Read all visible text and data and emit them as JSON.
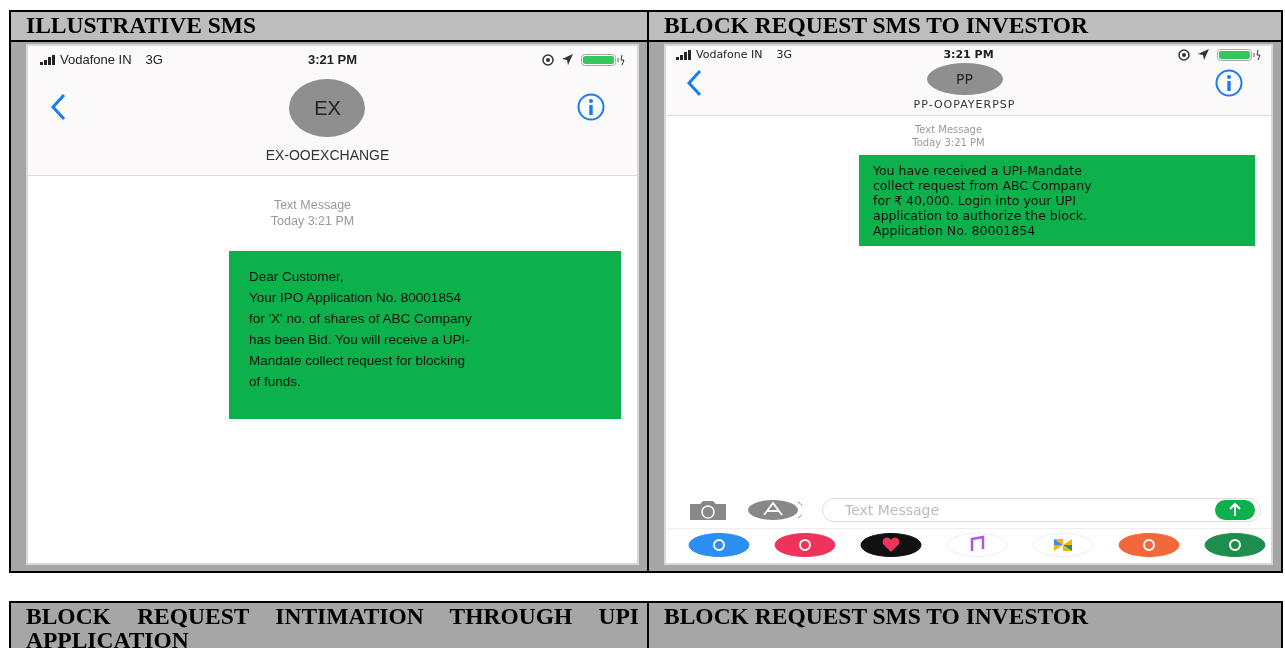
{
  "panels": [
    {
      "heading": "ILLUSTRATIVE SMS",
      "phone": {
        "carrier": "Vodafone IN",
        "network": "3G",
        "time": "3:21 PM",
        "contact_initials": "EX",
        "contact_name": "EX-OOEXCHANGE",
        "message_type": "Text Message",
        "message_time": "Today 3:21 PM",
        "message_text": "Dear Customer,\nYour IPO Application No. 80001854\nfor 'X' no. of shares of ABC Company\nhas been Bid. You will receive a UPI-\nMandate collect request for blocking\nof funds."
      }
    },
    {
      "heading": "BLOCK REQUEST SMS TO INVESTOR",
      "phone": {
        "carrier": "Vodafone IN",
        "network": "3G",
        "time": "3:21 PM",
        "contact_initials": "PP",
        "contact_name": "PP-OOPAYERPSP",
        "message_type": "Text Message",
        "message_time": "Today 3:21 PM",
        "message_text": "You have received a UPI-Mandate\ncollect request from ABC Company\nfor ₹ 40,000. Login into your UPI\napplication to authorize the block.\nApplication No. 80001854",
        "composer": {
          "placeholder": "Text Message"
        }
      }
    }
  ],
  "lower_headings": [
    "BLOCK REQUEST INTIMATION THROUGH UPI APPLICATION",
    "BLOCK REQUEST SMS TO INVESTOR"
  ]
}
